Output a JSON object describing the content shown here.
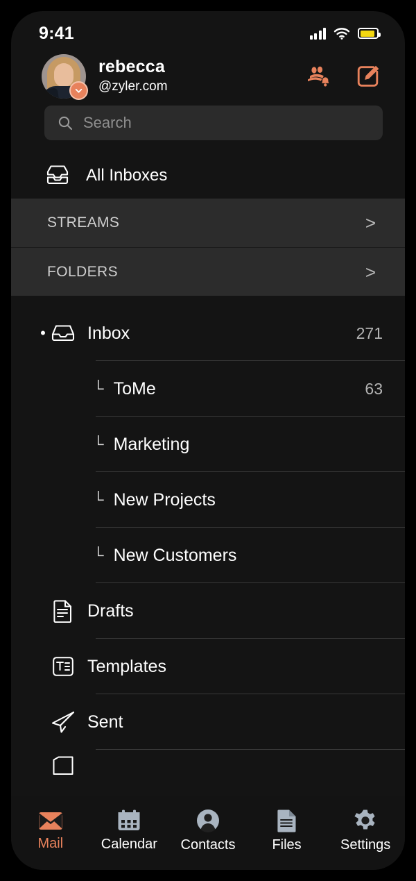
{
  "status_bar": {
    "time": "9:41",
    "signal_icon": "cellular-signal-icon",
    "wifi_icon": "wifi-icon",
    "battery_icon": "battery-icon",
    "battery_color": "#f3d711"
  },
  "account": {
    "name": "rebecca",
    "domain": "@zyler.com",
    "avatar_alt": "rebecca-avatar",
    "badge_icon": "chevron-down-icon",
    "actions": [
      {
        "name": "contacts-notifications-button",
        "icon": "people-bell-icon"
      },
      {
        "name": "compose-button",
        "icon": "compose-pencil-square-icon"
      }
    ],
    "accent_color": "#e8825c"
  },
  "search": {
    "placeholder": "Search",
    "icon": "search-icon"
  },
  "all_inboxes": {
    "label": "All Inboxes",
    "icon": "stacked-inbox-icon"
  },
  "sections": [
    {
      "label": "STREAMS",
      "chevron": ">"
    },
    {
      "label": "FOLDERS",
      "chevron": ">"
    }
  ],
  "mailboxes": [
    {
      "name": "Inbox",
      "count": "271",
      "icon": "inbox-tray-icon",
      "bullet": "•",
      "level": 0
    },
    {
      "name": "ToMe",
      "count": "63",
      "branch": "└",
      "level": 1
    },
    {
      "name": "Marketing",
      "count": "",
      "branch": "└",
      "level": 1
    },
    {
      "name": "New Projects",
      "count": "",
      "branch": "└",
      "level": 1
    },
    {
      "name": "New Customers",
      "count": "",
      "branch": "└",
      "level": 1
    },
    {
      "name": "Drafts",
      "count": "",
      "icon": "draft-document-icon",
      "level": 0
    },
    {
      "name": "Templates",
      "count": "",
      "icon": "template-icon",
      "level": 0
    },
    {
      "name": "Sent",
      "count": "",
      "icon": "paper-plane-icon",
      "level": 0
    }
  ],
  "tabs": [
    {
      "label": "Mail",
      "icon": "envelope-icon",
      "active": true
    },
    {
      "label": "Calendar",
      "icon": "calendar-icon",
      "active": false
    },
    {
      "label": "Contacts",
      "icon": "person-circle-icon",
      "active": false
    },
    {
      "label": "Files",
      "icon": "document-icon",
      "active": false
    },
    {
      "label": "Settings",
      "icon": "gear-icon",
      "active": false
    }
  ]
}
